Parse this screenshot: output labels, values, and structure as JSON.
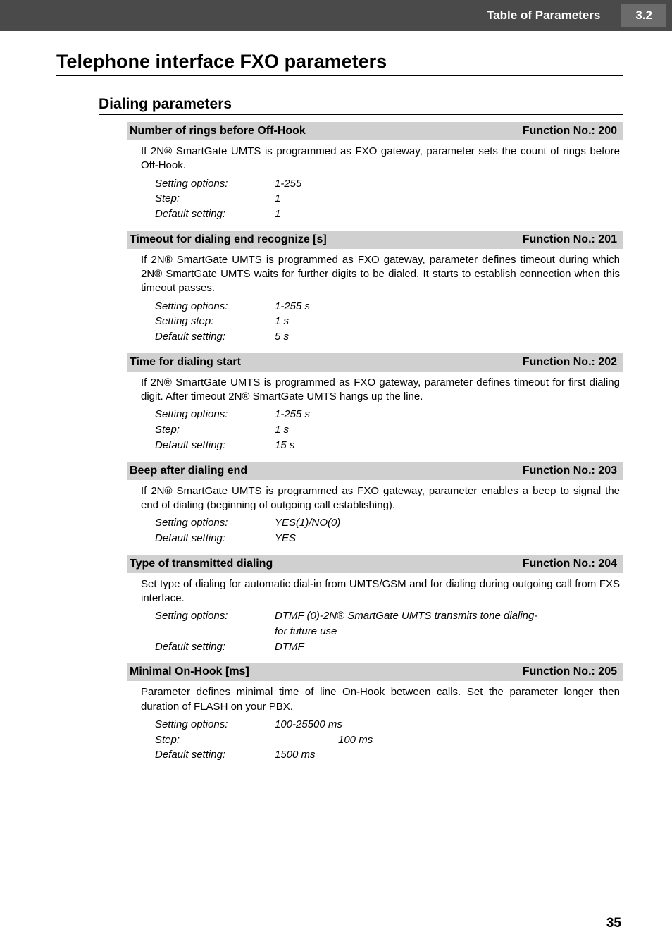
{
  "header": {
    "title": "Table of Parameters",
    "section": "3.2"
  },
  "h1": "Telephone interface FXO parameters",
  "h2": "Dialing parameters",
  "params": [
    {
      "title": "Number of rings before Off-Hook",
      "fn": "Function No.: 200",
      "desc": "If 2N® SmartGate UMTS is programmed as FXO gateway, parameter sets the count of rings before Off-Hook.",
      "rows": [
        {
          "label": "Setting options:",
          "value": "1-255"
        },
        {
          "label": "Step:",
          "value": "1"
        },
        {
          "label": "Default setting:",
          "value": "1"
        }
      ]
    },
    {
      "title": "Timeout for dialing end recognize [s]",
      "fn": "Function No.: 201",
      "desc": "If 2N® SmartGate UMTS is programmed as FXO gateway, parameter defines timeout during which 2N® SmartGate UMTS waits for further digits to be dialed. It starts to establish connection when this timeout passes.",
      "rows": [
        {
          "label": "Setting options:",
          "value": "1-255 s"
        },
        {
          "label": "Setting step:",
          "value": "1 s"
        },
        {
          "label": "Default setting:",
          "value": "5 s"
        }
      ]
    },
    {
      "title": "Time for dialing start",
      "fn": "Function No.: 202",
      "desc": "If 2N® SmartGate UMTS is programmed as FXO gateway, parameter defines timeout for first dialing digit. After timeout 2N® SmartGate UMTS hangs up the line.",
      "rows": [
        {
          "label": "Setting options:",
          "value": "1-255 s"
        },
        {
          "label": "Step:",
          "value": "1 s"
        },
        {
          "label": "Default setting:",
          "value": "15 s"
        }
      ]
    },
    {
      "title": "Beep after dialing end",
      "fn": "Function No.: 203",
      "desc": "If 2N® SmartGate UMTS is programmed as FXO gateway, parameter enables a beep to signal the end of dialing (beginning of outgoing call establishing).",
      "rows": [
        {
          "label": "Setting options:",
          "value": "YES(1)/NO(0)"
        },
        {
          "label": "Default setting:",
          "value": "YES"
        }
      ]
    },
    {
      "title": "Type of transmitted dialing",
      "fn": "Function No.: 204",
      "desc": "Set type of dialing for automatic dial-in from UMTS/GSM and for dialing during outgoing call from FXS interface.",
      "rows": [
        {
          "label": "Setting options:",
          "value": "DTMF (0)-2N® SmartGate UMTS transmits tone dialing-",
          "extra": "for future use"
        },
        {
          "label": "Default setting:",
          "value": "DTMF"
        }
      ]
    },
    {
      "title": "Minimal On-Hook [ms]",
      "fn": "Function No.: 205",
      "desc": "Parameter defines minimal time of line On-Hook between calls. Set the parameter longer then duration of FLASH on your PBX.",
      "rows": [
        {
          "label": "Setting options:",
          "value": "100-25500 ms"
        },
        {
          "label": "Step:",
          "value": "100 ms",
          "stepIndent": true
        },
        {
          "label": "Default setting:",
          "value": "1500 ms"
        }
      ]
    }
  ],
  "pageNumber": "35"
}
